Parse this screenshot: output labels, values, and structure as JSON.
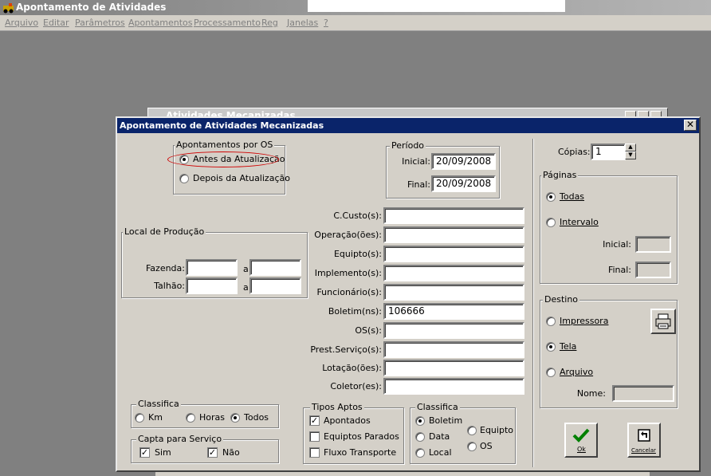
{
  "app": {
    "title": "Apontamento de Atividades",
    "menu": [
      "Arquivo",
      "Editar",
      "Parâmetros",
      "Apontamentos",
      "Processamento",
      "Reg",
      "Janelas",
      "?"
    ]
  },
  "background_window": {
    "title": "Atividades Mecanizadas"
  },
  "dialog": {
    "title": "Apontamento de Atividades Mecanizadas",
    "close_glyph": "✕",
    "apontamentos": {
      "legend": "Apontamentos por OS",
      "options": [
        "Antes da Atualização",
        "Depois da Atualização"
      ],
      "selected": 0
    },
    "periodo": {
      "legend": "Período",
      "inicial_label": "Inicial:",
      "inicial_value": "20/09/2008",
      "final_label": "Final:",
      "final_value": "20/09/2008"
    },
    "local": {
      "legend": "Local de Produção",
      "fazenda_label": "Fazenda:",
      "talhao_label": "Talhão:",
      "a": "a"
    },
    "filters": [
      {
        "label": "C.Custo(s):",
        "value": ""
      },
      {
        "label": "Operação(ões):",
        "value": ""
      },
      {
        "label": "Equipto(s):",
        "value": ""
      },
      {
        "label": "Implemento(s):",
        "value": ""
      },
      {
        "label": "Funcionário(s):",
        "value": ""
      },
      {
        "label": "Boletim(ns):",
        "value": "106666"
      },
      {
        "label": "OS(s):",
        "value": ""
      },
      {
        "label": "Prest.Serviço(s):",
        "value": ""
      },
      {
        "label": "Lotação(ões):",
        "value": ""
      },
      {
        "label": "Coletor(es):",
        "value": ""
      }
    ],
    "classifica1": {
      "legend": "Classifica",
      "options": [
        "Km",
        "Horas",
        "Todos"
      ],
      "selected": 2
    },
    "capta": {
      "legend": "Capta para Serviço",
      "sim": "Sim",
      "nao": "Não",
      "sim_checked": true,
      "nao_checked": true
    },
    "tipos": {
      "legend": "Tipos Aptos",
      "items": [
        {
          "label": "Apontados",
          "checked": true
        },
        {
          "label": "Equiptos Parados",
          "checked": false
        },
        {
          "label": "Fluxo Transporte",
          "checked": false
        }
      ]
    },
    "classifica2": {
      "legend": "Classifica",
      "options": [
        "Boletim",
        "Data",
        "Local",
        "Equipto",
        "OS"
      ],
      "selected": 0
    },
    "copias": {
      "label": "Cópias:",
      "value": "1"
    },
    "paginas": {
      "legend": "Páginas",
      "todas": "Todas",
      "intervalo": "Intervalo",
      "selected": "todas",
      "inicial_label": "Inicial:",
      "final_label": "Final:"
    },
    "destino": {
      "legend": "Destino",
      "options": [
        "Impressora",
        "Tela",
        "Arquivo"
      ],
      "selected": 1,
      "nome_label": "Nome:"
    },
    "ok_label": "Ok",
    "cancel_label": "Cancelar"
  }
}
